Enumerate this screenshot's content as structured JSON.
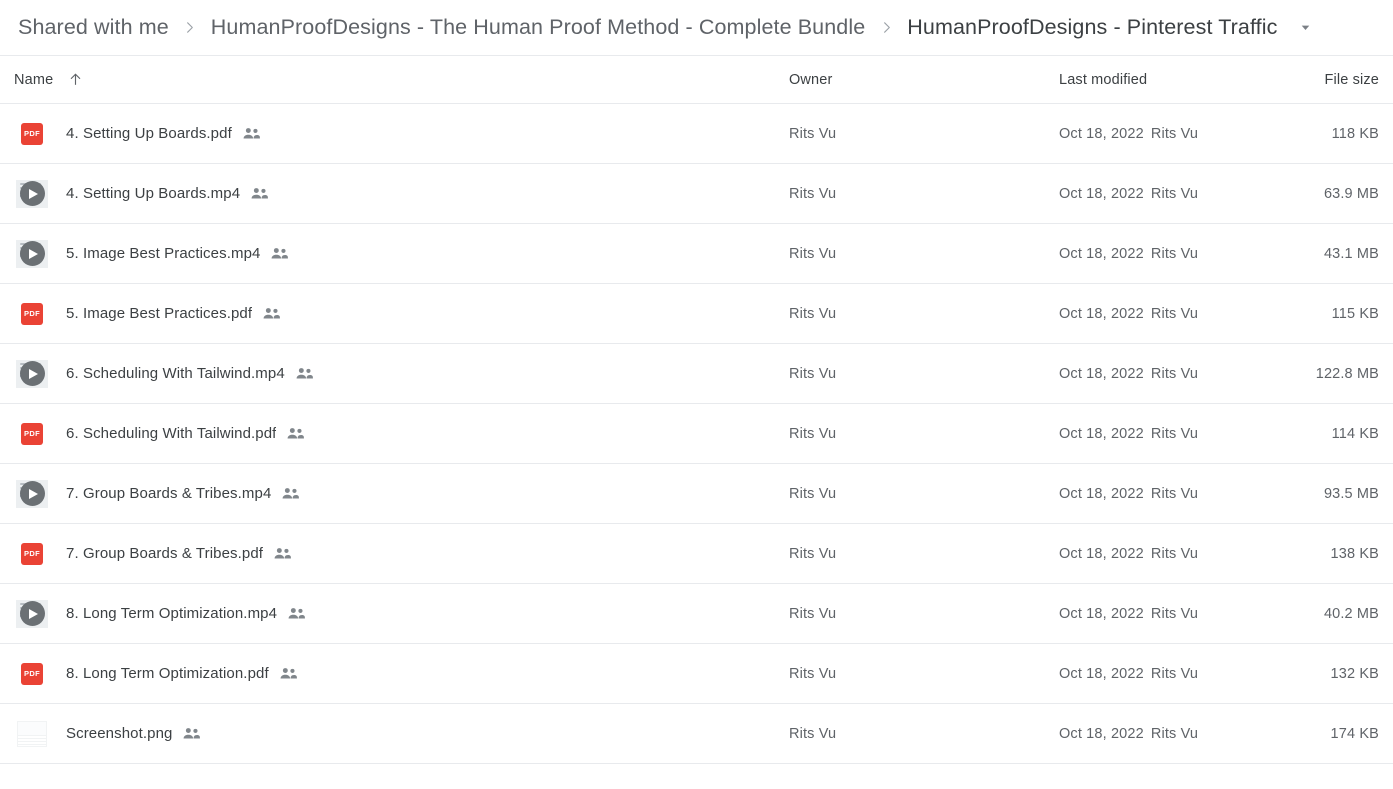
{
  "breadcrumb": {
    "items": [
      {
        "label": "Shared with me",
        "current": false
      },
      {
        "label": "HumanProofDesigns - The Human Proof Method - Complete Bundle",
        "current": false
      },
      {
        "label": "HumanProofDesigns - Pinterest Traffic",
        "current": true
      }
    ],
    "separator_icon": "chevron-right-icon",
    "caret_icon": "caret-down-icon"
  },
  "columns": {
    "name": "Name",
    "owner": "Owner",
    "last_modified": "Last modified",
    "file_size": "File size",
    "sort_icon": "arrow-up-icon",
    "sort_direction": "ascending"
  },
  "files": [
    {
      "name": "4.  Setting Up Boards.pdf",
      "icon": "pdf-icon",
      "shared": true,
      "owner": "Rits Vu",
      "modified_date": "Oct 18, 2022",
      "modified_by": "Rits Vu",
      "size": "118 KB"
    },
    {
      "name": "4. Setting Up Boards.mp4",
      "icon": "video-icon",
      "shared": true,
      "owner": "Rits Vu",
      "modified_date": "Oct 18, 2022",
      "modified_by": "Rits Vu",
      "size": "63.9 MB"
    },
    {
      "name": "5. Image Best Practices.mp4",
      "icon": "video-icon",
      "shared": true,
      "owner": "Rits Vu",
      "modified_date": "Oct 18, 2022",
      "modified_by": "Rits Vu",
      "size": "43.1 MB"
    },
    {
      "name": "5. Image Best Practices.pdf",
      "icon": "pdf-icon",
      "shared": true,
      "owner": "Rits Vu",
      "modified_date": "Oct 18, 2022",
      "modified_by": "Rits Vu",
      "size": "115 KB"
    },
    {
      "name": "6. Scheduling With Tailwind.mp4",
      "icon": "video-icon",
      "shared": true,
      "owner": "Rits Vu",
      "modified_date": "Oct 18, 2022",
      "modified_by": "Rits Vu",
      "size": "122.8 MB"
    },
    {
      "name": "6. Scheduling With Tailwind.pdf",
      "icon": "pdf-icon",
      "shared": true,
      "owner": "Rits Vu",
      "modified_date": "Oct 18, 2022",
      "modified_by": "Rits Vu",
      "size": "114 KB"
    },
    {
      "name": "7. Group Boards & Tribes.mp4",
      "icon": "video-icon",
      "shared": true,
      "owner": "Rits Vu",
      "modified_date": "Oct 18, 2022",
      "modified_by": "Rits Vu",
      "size": "93.5 MB"
    },
    {
      "name": "7. Group Boards & Tribes.pdf",
      "icon": "pdf-icon",
      "shared": true,
      "owner": "Rits Vu",
      "modified_date": "Oct 18, 2022",
      "modified_by": "Rits Vu",
      "size": "138 KB"
    },
    {
      "name": "8. Long Term Optimization.mp4",
      "icon": "video-icon",
      "shared": true,
      "owner": "Rits Vu",
      "modified_date": "Oct 18, 2022",
      "modified_by": "Rits Vu",
      "size": "40.2 MB"
    },
    {
      "name": "8. Long Term Optimization.pdf",
      "icon": "pdf-icon",
      "shared": true,
      "owner": "Rits Vu",
      "modified_date": "Oct 18, 2022",
      "modified_by": "Rits Vu",
      "size": "132 KB"
    },
    {
      "name": "Screenshot.png",
      "icon": "image-icon",
      "shared": true,
      "owner": "Rits Vu",
      "modified_date": "Oct 18, 2022",
      "modified_by": "Rits Vu",
      "size": "174 KB"
    }
  ],
  "colors": {
    "pdf_red": "#ea4335",
    "text_primary": "#3c4043",
    "text_secondary": "#5f6368",
    "divider": "#e8eaed"
  },
  "icon_labels": {
    "pdf": "PDF"
  }
}
